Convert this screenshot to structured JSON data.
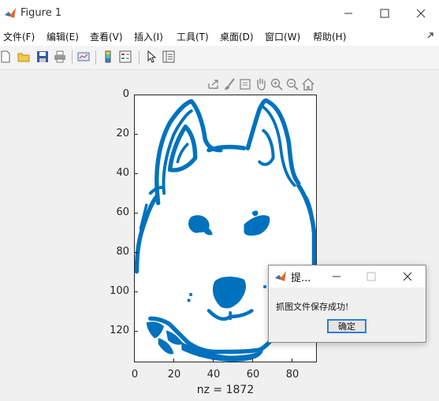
{
  "window": {
    "title": "Figure 1"
  },
  "menu": [
    "文件(F)",
    "编辑(E)",
    "查看(V)",
    "插入(I)",
    "工具(T)",
    "桌面(D)",
    "窗口(W)",
    "帮助(H)"
  ],
  "toolbar": [
    "new-figure",
    "open-file",
    "save-figure",
    "print-figure",
    "link-plot",
    "insert-colorbar",
    "insert-legend",
    "edit-plot",
    "property-inspector"
  ],
  "axes_toolbar": [
    "export",
    "brush",
    "datatips",
    "pan",
    "zoom-in",
    "zoom-out",
    "home"
  ],
  "colors": {
    "plot": "#0072bd",
    "window_bg": "#f0f0f0",
    "ok_border": "#2f7fd6"
  },
  "chart_data": {
    "type": "scatter",
    "description_source": "spy plot of sparse matrix (dog face outline)",
    "xlabel": "nz = 1872",
    "x_ticks": [
      "0",
      "20",
      "40",
      "60",
      "80"
    ],
    "y_ticks": [
      "0",
      "20",
      "40",
      "60",
      "80",
      "100",
      "120"
    ],
    "xlim": [
      0,
      93
    ],
    "ylim": [
      0,
      136
    ],
    "y_direction": "reversed",
    "marker_color": "#0072bd",
    "nz": 1872
  },
  "dialog": {
    "title": "提...",
    "message": "抓图文件保存成功!",
    "ok_label": "确定"
  }
}
